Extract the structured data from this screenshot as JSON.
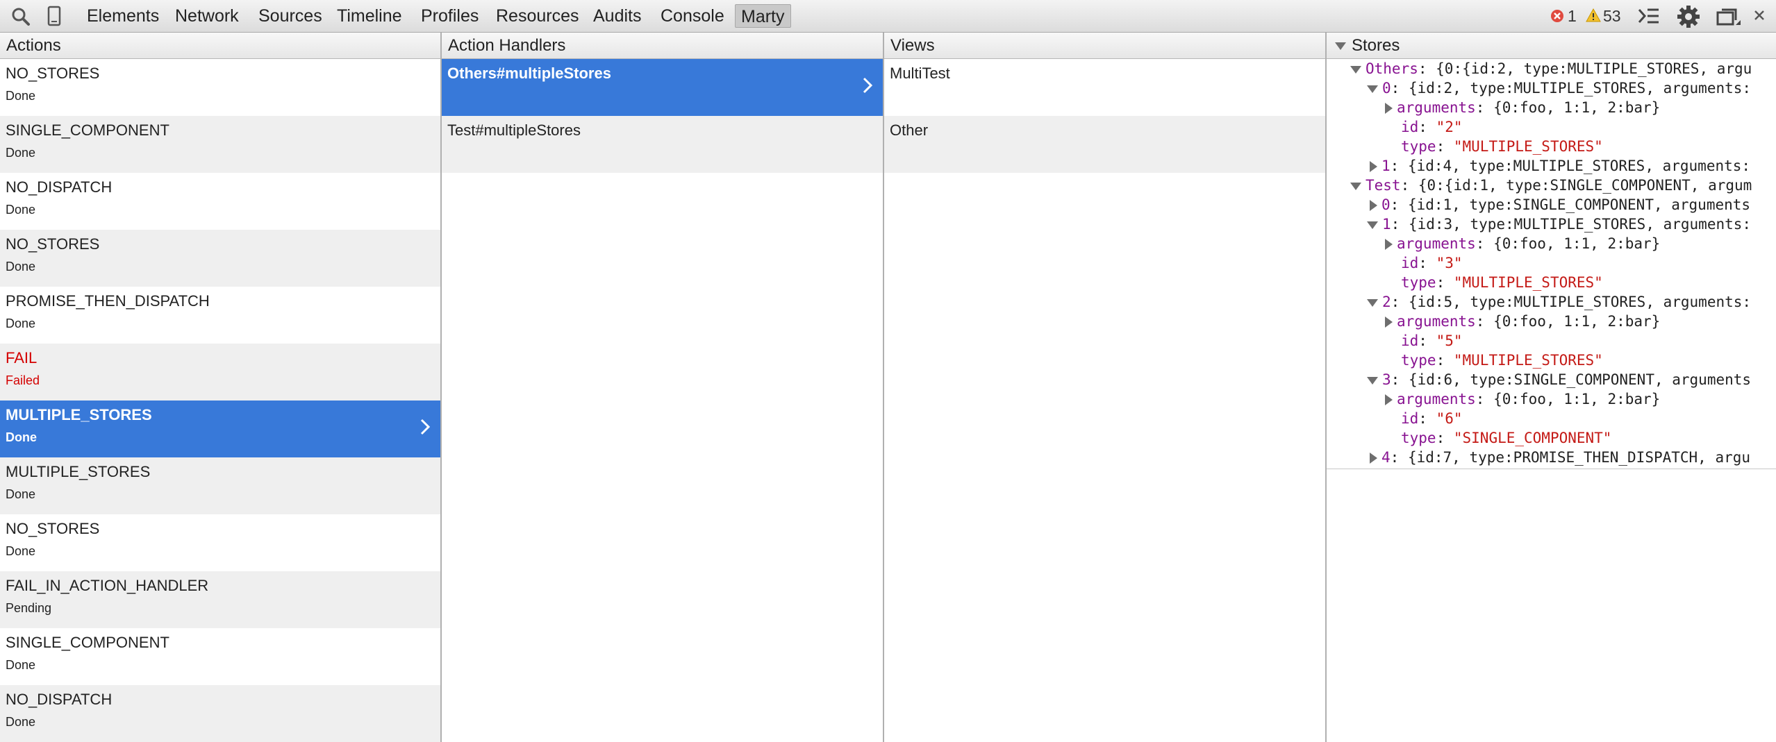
{
  "toolbar": {
    "tabs": [
      "Elements",
      "Network",
      "Sources",
      "Timeline",
      "Profiles",
      "Resources",
      "Audits",
      "Console",
      "Marty"
    ],
    "active_tab": "Marty",
    "error_count": "1",
    "warning_count": "53",
    "icons": [
      "search-icon",
      "device-mode-icon",
      "console-drawer-icon",
      "settings-gear-icon",
      "dock-icon",
      "close-icon"
    ]
  },
  "actions": {
    "header": "Actions",
    "items": [
      {
        "name": "NO_STORES",
        "status": "Done"
      },
      {
        "name": "SINGLE_COMPONENT",
        "status": "Done"
      },
      {
        "name": "NO_DISPATCH",
        "status": "Done"
      },
      {
        "name": "NO_STORES",
        "status": "Done"
      },
      {
        "name": "PROMISE_THEN_DISPATCH",
        "status": "Done"
      },
      {
        "name": "FAIL",
        "status": "Failed"
      },
      {
        "name": "MULTIPLE_STORES",
        "status": "Done"
      },
      {
        "name": "MULTIPLE_STORES",
        "status": "Done"
      },
      {
        "name": "NO_STORES",
        "status": "Done"
      },
      {
        "name": "FAIL_IN_ACTION_HANDLER",
        "status": "Pending"
      },
      {
        "name": "SINGLE_COMPONENT",
        "status": "Done"
      },
      {
        "name": "NO_DISPATCH",
        "status": "Done"
      }
    ]
  },
  "handlers": {
    "header": "Action Handlers",
    "items": [
      "Others#multipleStores",
      "Test#multipleStores"
    ]
  },
  "views": {
    "header": "Views",
    "items": [
      "MultiTest",
      "Other"
    ]
  },
  "stores": {
    "header": "Stores",
    "lines": [
      {
        "key": "Others",
        "sep": ": ",
        "val": "{0:{id:2, type:MULTIPLE_STORES, argu"
      },
      {
        "key": "0",
        "sep": ": ",
        "val": "{id:2, type:MULTIPLE_STORES, arguments:"
      },
      {
        "key": "arguments",
        "sep": ": ",
        "val": "{0:foo, 1:1, 2:bar}"
      },
      {
        "key": "id",
        "sep": ": ",
        "val": "\"2\""
      },
      {
        "key": "type",
        "sep": ": ",
        "val": "\"MULTIPLE_STORES\""
      },
      {
        "key": "1",
        "sep": ": ",
        "val": "{id:4, type:MULTIPLE_STORES, arguments:"
      },
      {
        "key": "Test",
        "sep": ": ",
        "val": "{0:{id:1, type:SINGLE_COMPONENT, argum"
      },
      {
        "key": "0",
        "sep": ": ",
        "val": "{id:1, type:SINGLE_COMPONENT, arguments"
      },
      {
        "key": "1",
        "sep": ": ",
        "val": "{id:3, type:MULTIPLE_STORES, arguments:"
      },
      {
        "key": "arguments",
        "sep": ": ",
        "val": "{0:foo, 1:1, 2:bar}"
      },
      {
        "key": "id",
        "sep": ": ",
        "val": "\"3\""
      },
      {
        "key": "type",
        "sep": ": ",
        "val": "\"MULTIPLE_STORES\""
      },
      {
        "key": "2",
        "sep": ": ",
        "val": "{id:5, type:MULTIPLE_STORES, arguments:"
      },
      {
        "key": "arguments",
        "sep": ": ",
        "val": "{0:foo, 1:1, 2:bar}"
      },
      {
        "key": "id",
        "sep": ": ",
        "val": "\"5\""
      },
      {
        "key": "type",
        "sep": ": ",
        "val": "\"MULTIPLE_STORES\""
      },
      {
        "key": "3",
        "sep": ": ",
        "val": "{id:6, type:SINGLE_COMPONENT, arguments"
      },
      {
        "key": "arguments",
        "sep": ": ",
        "val": "{0:foo, 1:1, 2:bar}"
      },
      {
        "key": "id",
        "sep": ": ",
        "val": "\"6\""
      },
      {
        "key": "type",
        "sep": ": ",
        "val": "\"SINGLE_COMPONENT\""
      },
      {
        "key": "4",
        "sep": ": ",
        "val": "{id:7, type:PROMISE_THEN_DISPATCH, argu"
      }
    ]
  },
  "colors": {
    "selection": "#3879d9",
    "failed": "#d40000",
    "key_purple": "#881391",
    "string_red": "#c41a16"
  }
}
